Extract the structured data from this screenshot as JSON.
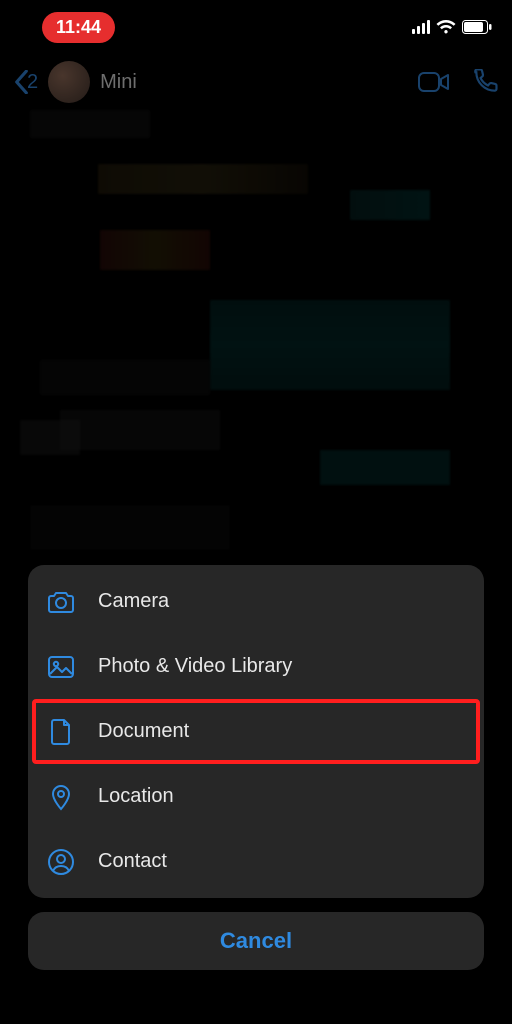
{
  "status": {
    "time": "11:44"
  },
  "nav": {
    "back_count": "2",
    "contact_name": "Mini"
  },
  "sheet": {
    "items": [
      {
        "icon": "camera-icon",
        "label": "Camera"
      },
      {
        "icon": "photo-icon",
        "label": "Photo & Video Library"
      },
      {
        "icon": "document-icon",
        "label": "Document"
      },
      {
        "icon": "location-icon",
        "label": "Location"
      },
      {
        "icon": "contact-icon",
        "label": "Contact"
      }
    ],
    "highlighted_index": 2,
    "cancel_label": "Cancel"
  },
  "colors": {
    "accent": "#2f8ae0",
    "highlight": "#ff1e1e",
    "sheet_bg": "#272727"
  }
}
